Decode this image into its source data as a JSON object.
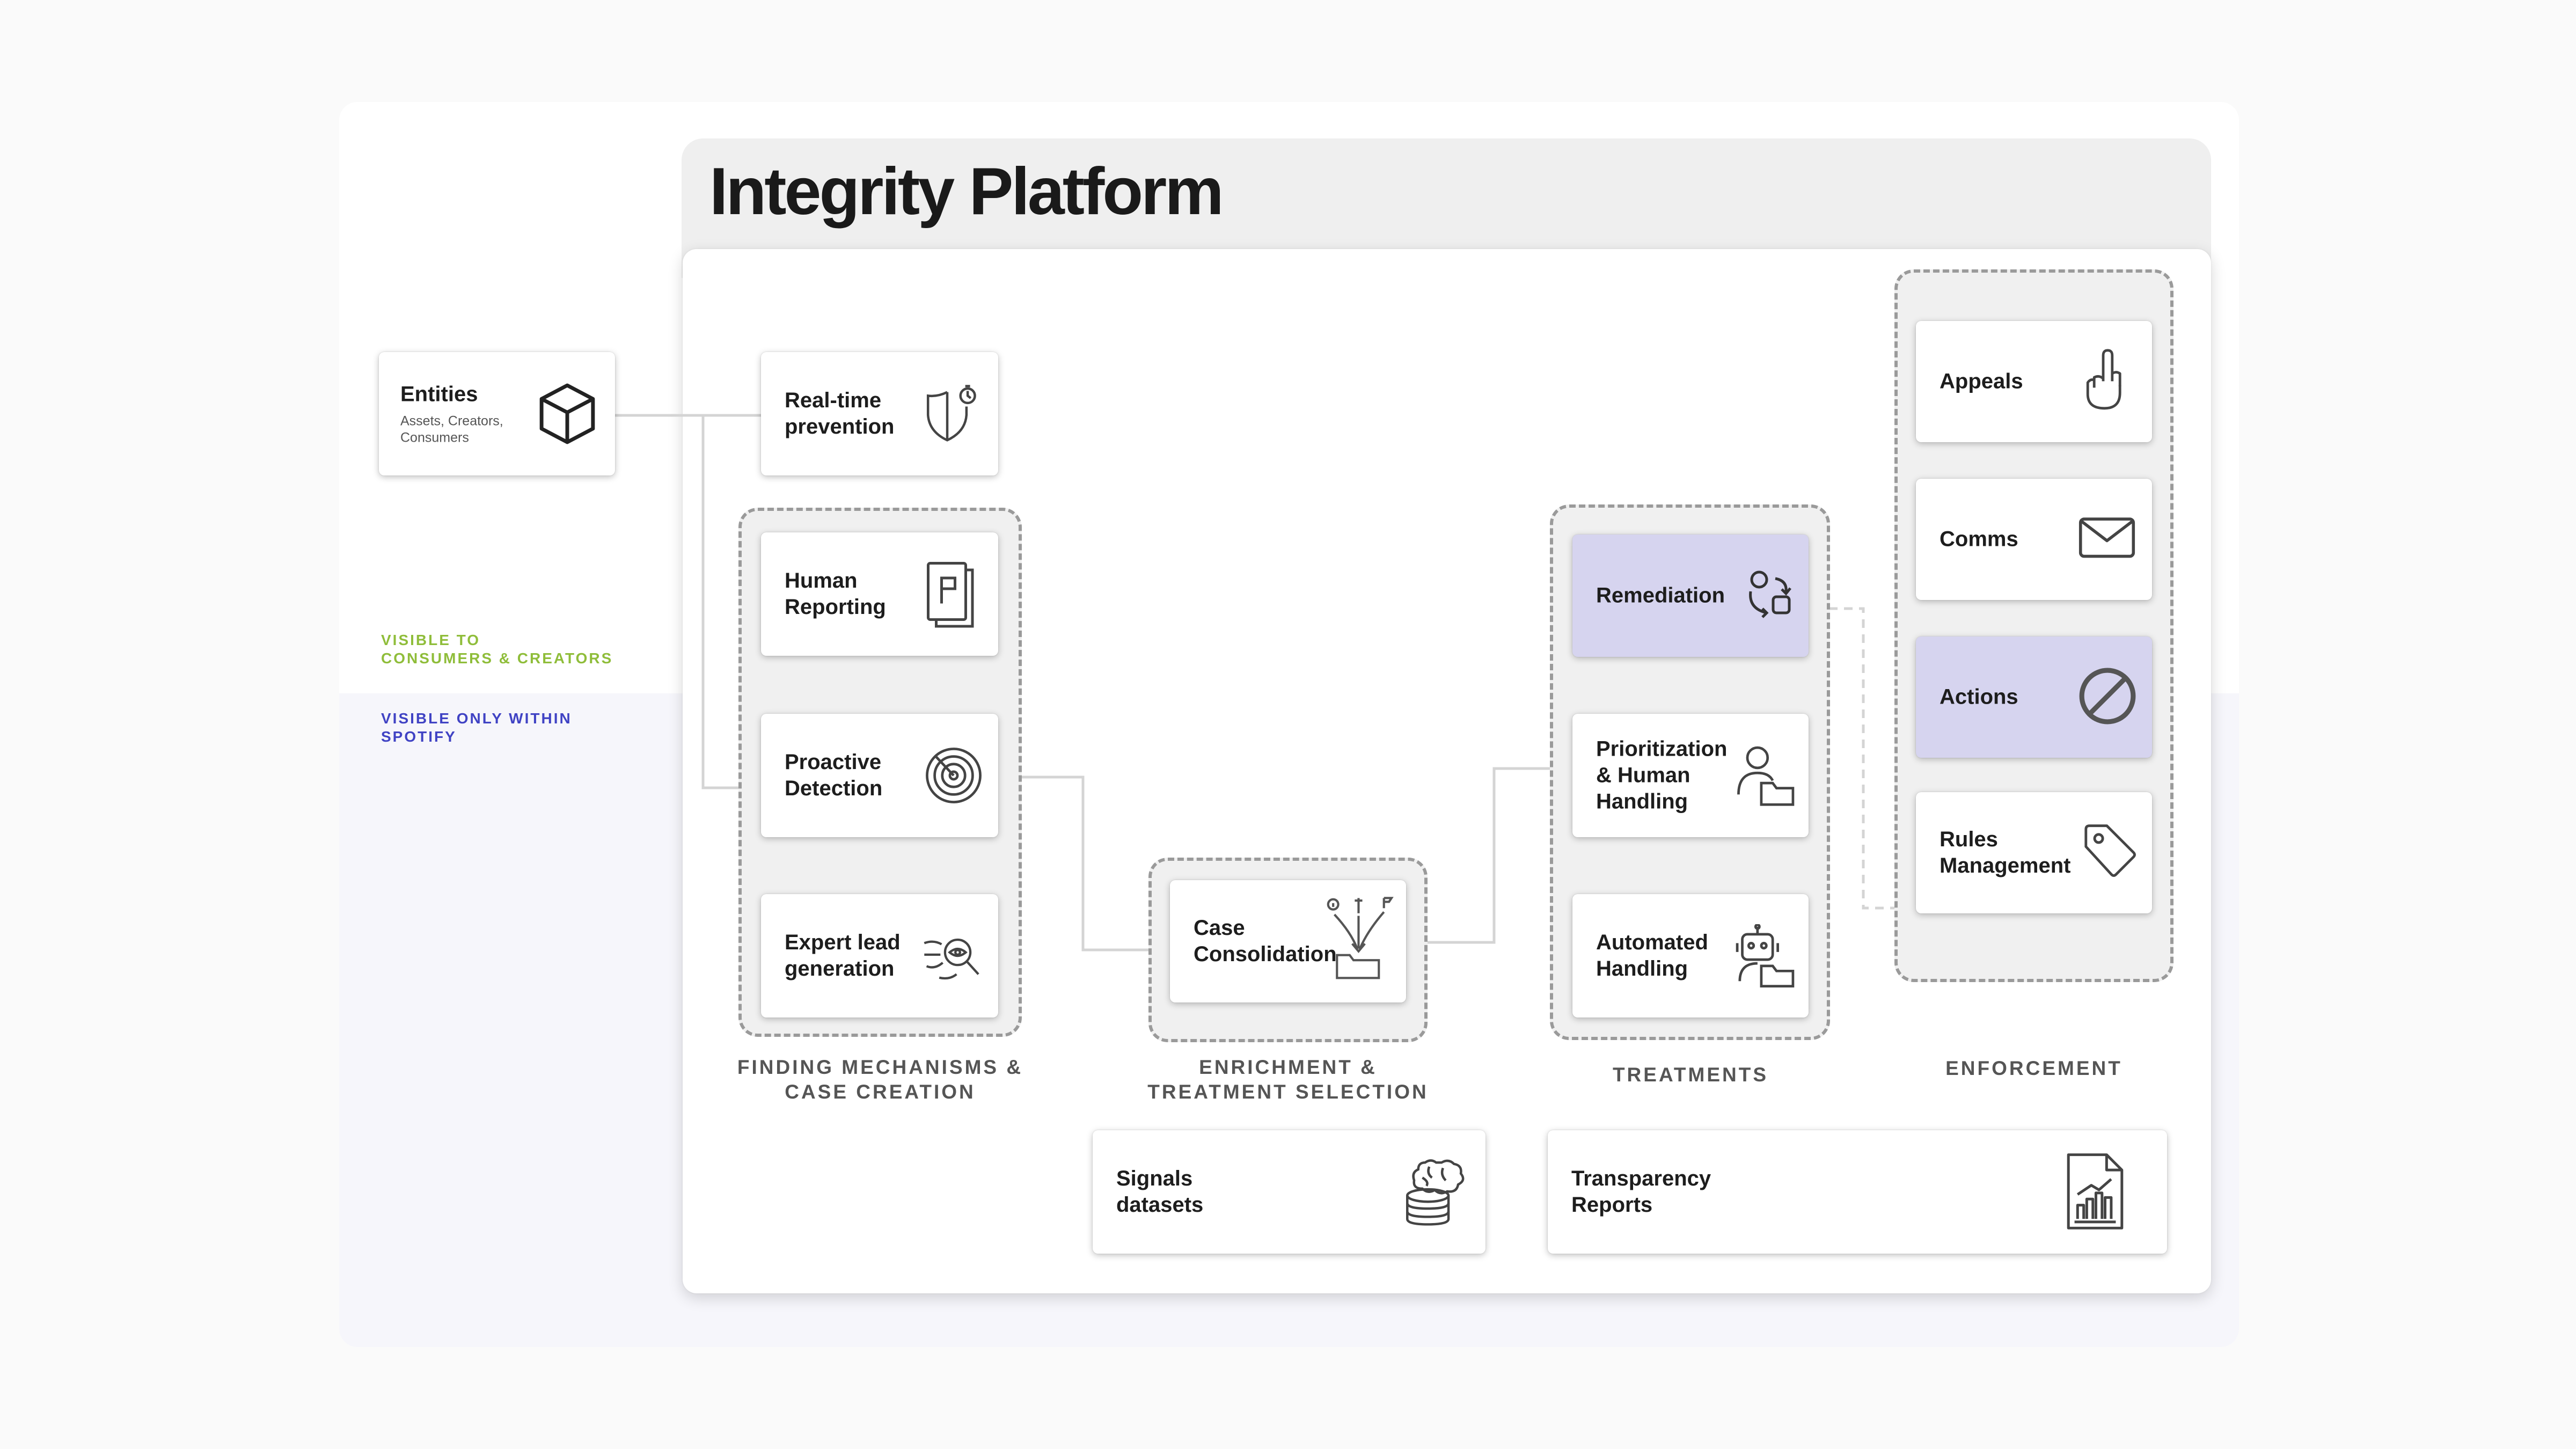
{
  "title": "Integrity Platform",
  "visibility": {
    "consumers_creators": "VISIBLE TO\nCONSUMERS & CREATORS",
    "spotify_only": "VISIBLE ONLY WITHIN\nSPOTIFY"
  },
  "entities": {
    "label": "Entities",
    "sub": "Assets, Creators,\nConsumers",
    "icon": "cube-icon"
  },
  "realtime": {
    "label": "Real-time\nprevention",
    "icon": "shield-timer-icon"
  },
  "finding": {
    "caption": "FINDING MECHANISMS &\nCASE CREATION",
    "items": [
      {
        "label": "Human\nReporting",
        "icon": "report-flag-icon"
      },
      {
        "label": "Proactive\nDetection",
        "icon": "radar-icon"
      },
      {
        "label": "Expert lead\ngeneration",
        "icon": "magnifier-eye-icon"
      }
    ]
  },
  "enrichment": {
    "caption": "ENRICHMENT &\nTREATMENT SELECTION",
    "items": [
      {
        "label": "Case\nConsolidation",
        "icon": "folder-merge-icon"
      }
    ]
  },
  "treatments": {
    "caption": "TREATMENTS",
    "items": [
      {
        "label": "Remediation",
        "icon": "person-cycle-icon",
        "highlighted": true
      },
      {
        "label": "Prioritization\n& Human\nHandling",
        "icon": "person-folder-icon"
      },
      {
        "label": "Automated\nHandling",
        "icon": "robot-folder-icon"
      }
    ]
  },
  "enforcement": {
    "caption": "ENFORCEMENT",
    "items": [
      {
        "label": "Appeals",
        "icon": "raised-hand-icon"
      },
      {
        "label": "Comms",
        "icon": "envelope-icon"
      },
      {
        "label": "Actions",
        "icon": "prohibited-icon",
        "highlighted": true
      },
      {
        "label": "Rules\nManagement",
        "icon": "tag-icon"
      }
    ]
  },
  "signals": {
    "label": "Signals\ndatasets",
    "icon": "brain-database-icon"
  },
  "transparency": {
    "label": "Transparency\nReports",
    "icon": "report-chart-icon"
  },
  "colors": {
    "highlight": "#d6d4ef",
    "consumers_label": "#8fbd3a",
    "spotify_label": "#4043c4",
    "group_fill": "#f0f0f0"
  }
}
